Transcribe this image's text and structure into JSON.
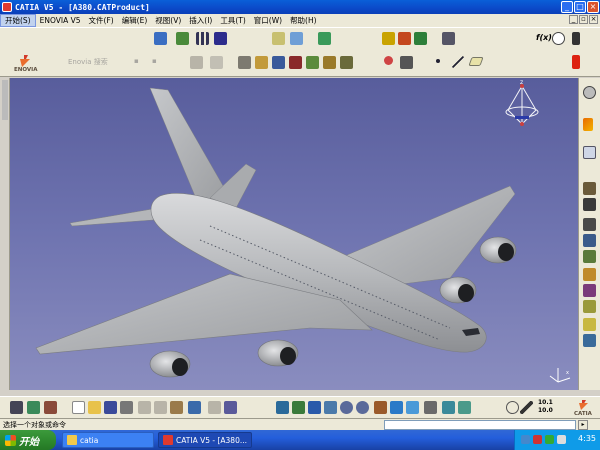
{
  "window": {
    "title": "CATIA V5 - [A380.CATProduct]",
    "controls": {
      "minimize": "_",
      "maximize": "□",
      "close": "×"
    }
  },
  "menu": {
    "items": [
      "开始(S)",
      "ENOVIA V5",
      "文件(F)",
      "编辑(E)",
      "视图(V)",
      "插入(I)",
      "工具(T)",
      "窗口(W)",
      "帮助(H)"
    ],
    "doc_controls": {
      "minimize": "_",
      "restore": "▫",
      "close": "×"
    }
  },
  "toolbar": {
    "brand_top": "ENOVIA",
    "disabled_labels": [
      "Enovia 搜索",
      "▪",
      "▪"
    ],
    "formula_label": "f(x)"
  },
  "viewport": {
    "background_top": "#585d9c",
    "background_bottom": "#8a8dbf",
    "model": "A380 aircraft",
    "model_color": "#b8babd",
    "compass_labels": [
      "z",
      "x",
      "y"
    ]
  },
  "bottom_toolbar": {
    "zoom_top": "10.1",
    "zoom_bottom": "10.0",
    "brand": "CATIA"
  },
  "status": {
    "message": "选择一个对象或命令",
    "command_input": "",
    "command_button": "▸"
  },
  "taskbar": {
    "start_label": "开始",
    "tasks": [
      {
        "label": "catia",
        "icon": "folder-icon"
      },
      {
        "label": "CATIA V5 - [A380...",
        "icon": "catia-icon"
      }
    ],
    "clock": "4:35",
    "colors": {
      "start": "#2f8a2f",
      "taskbar": "#245edb",
      "tray": "#0f9be8"
    }
  }
}
